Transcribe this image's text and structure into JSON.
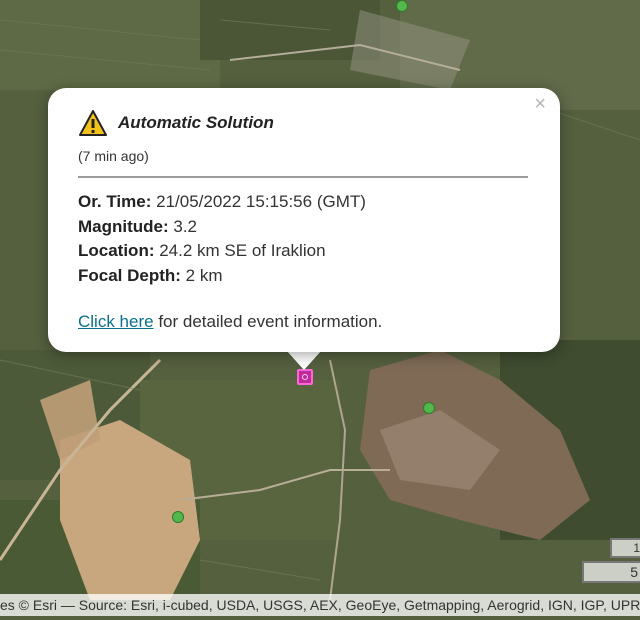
{
  "popup": {
    "title": "Automatic Solution",
    "ago": "(7 min ago)",
    "close_label": "×",
    "origin_time_label": "Or. Time:",
    "origin_time_value": " 21/05/2022 15:15:56 (GMT)",
    "magnitude_label": "Magnitude:",
    "magnitude_value": " 3.2",
    "location_label": "Location:",
    "location_value": " 24.2 km SE of Iraklion",
    "depth_label": "Focal Depth:",
    "depth_value": " 2 km",
    "link_text": "Click here",
    "link_suffix": " for detailed event information."
  },
  "map": {
    "attribution": "es © Esri — Source: Esri, i-cubed, USDA, USGS, AEX, GeoEye, Getmapping, Aerogrid, IGN, IGP, UPR-EGP",
    "scale_top": "1",
    "scale_bottom": "5"
  },
  "colors": {
    "station_marker": "#52b84a",
    "epicenter_marker": "#c02a9a",
    "link": "#0a6f8c"
  }
}
